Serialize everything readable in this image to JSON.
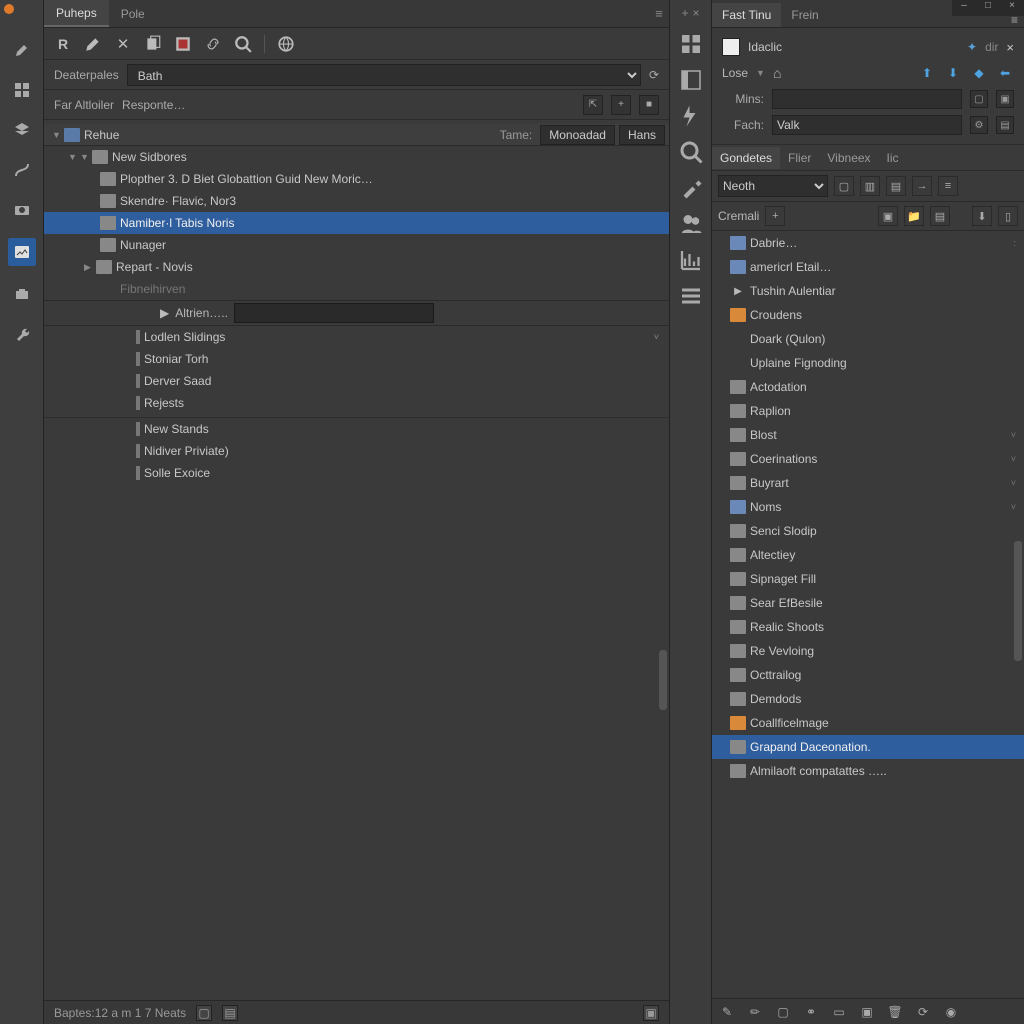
{
  "window": {
    "min": "–",
    "max": "□",
    "close": "×"
  },
  "leftTools": [
    "pencil",
    "grid",
    "layers",
    "curve",
    "camera",
    "image",
    "briefcase",
    "wrench"
  ],
  "main": {
    "tabs": {
      "active": "Puheps",
      "inactive": "Pole",
      "menu": "≡",
      "plus": "+",
      "x": "×"
    },
    "toolbar": [
      "R",
      "edit",
      "close",
      "copy",
      "swatch",
      "link",
      "zoom",
      "",
      "globe"
    ],
    "form1": {
      "label": "Deaterpales",
      "value": "Bath",
      "reset": "⟳"
    },
    "form2": {
      "label1": "Far Altloiler",
      "label2": "Responte…",
      "btn1": "⇱",
      "btn2": "+",
      "btn3": "■"
    },
    "root": {
      "label": "Rehue",
      "meta_label": "Tame:",
      "meta_a": "Monoadad",
      "meta_b": "Hans"
    },
    "items1": [
      "New Sidbores",
      "Plopther 3. D Biet Globattion Guid New Moric…",
      "Skendre·  Flavic, Nor3",
      "Namiber·l Tabis Noris",
      "Nunager",
      "Repart - Novis",
      "Fibneihirven"
    ],
    "atrien": "Altrien…..",
    "items2": [
      "Lodlen Slidings",
      "Stoniar Torh",
      "Derver Saad",
      "Rejests"
    ],
    "items3": [
      "New Stands",
      "Nidiver Priviate)",
      "Solle Exoice"
    ]
  },
  "status": {
    "text": "Baptes:12 a m 1 7 Neats"
  },
  "midTools": [
    "boxes",
    "panel",
    "bolt",
    "search",
    "tools",
    "people",
    "chart",
    "bars"
  ],
  "right": {
    "tabs": {
      "active": "Fast Tinu",
      "inactive": "Frein",
      "menu": "≡"
    },
    "prop": {
      "link": "Idaclic",
      "toggle_l": "✦",
      "toggle_r": "dir",
      "lose": "Lose",
      "home": "⌂",
      "mins": "Mins:",
      "mins_val": "",
      "fach": "Fach:",
      "fach_val": "Valk"
    },
    "subtabs": [
      "Gondetes",
      "Flier",
      "Vibneex",
      "Iic"
    ],
    "combobox": "Neoth",
    "row2label": "Cremali",
    "tree": [
      {
        "d": 0,
        "a": "down",
        "i": "fold",
        "t": "Dabrie…",
        "chev": ":"
      },
      {
        "d": 0,
        "a": "down",
        "i": "fold",
        "t": "americrl Etail…"
      },
      {
        "d": 1,
        "a": "",
        "i": "play",
        "t": "Tushin Aulentiar"
      },
      {
        "d": 0,
        "a": "down",
        "i": "oran",
        "t": "Croudens"
      },
      {
        "d": 2,
        "a": "right",
        "i": "",
        "t": "Doark (Qulon)"
      },
      {
        "d": 2,
        "a": "right",
        "i": "",
        "t": "Uplaine Fignoding"
      },
      {
        "d": 2,
        "a": "",
        "i": "doc",
        "t": "Actodation"
      },
      {
        "d": 2,
        "a": "",
        "i": "doc",
        "t": "Raplion"
      },
      {
        "d": 2,
        "a": "",
        "i": "doc",
        "t": "Blost",
        "chev": "˅"
      },
      {
        "d": 2,
        "a": "",
        "i": "doc",
        "t": "Coerinations",
        "chev": "˅"
      },
      {
        "d": 2,
        "a": "",
        "i": "doc",
        "t": "Buyrart",
        "chev": "˅"
      },
      {
        "d": 1,
        "a": "right",
        "i": "fold",
        "t": "Noms",
        "chev": "˅"
      },
      {
        "d": 2,
        "a": "",
        "i": "doc",
        "t": "Senci Slodip"
      },
      {
        "d": 2,
        "a": "",
        "i": "doc",
        "t": "Altectiey"
      },
      {
        "d": 2,
        "a": "",
        "i": "doc",
        "t": "Sipnaget Fill"
      },
      {
        "d": 2,
        "a": "",
        "i": "doc",
        "t": "Sear EfBesile"
      },
      {
        "d": 2,
        "a": "",
        "i": "doc",
        "t": "Realic Shoots"
      },
      {
        "d": 2,
        "a": "",
        "i": "doc",
        "t": "Re Vevloing"
      },
      {
        "d": 2,
        "a": "",
        "i": "doc",
        "t": "Octtrailog"
      },
      {
        "d": 2,
        "a": "",
        "i": "doc",
        "t": "Demdods"
      },
      {
        "d": 0,
        "a": "down",
        "i": "oran",
        "t": "Coallficelmage"
      },
      {
        "d": 1,
        "a": "",
        "i": "doc",
        "t": "Grapand Daceonation.",
        "sel": true
      },
      {
        "d": 1,
        "a": "",
        "i": "doc",
        "t": "Almilaoft compatattes ….."
      }
    ],
    "bottom": [
      "pen",
      "pencil",
      "box",
      "link",
      "rect",
      "layers",
      "trash",
      "refresh",
      "eye"
    ]
  }
}
